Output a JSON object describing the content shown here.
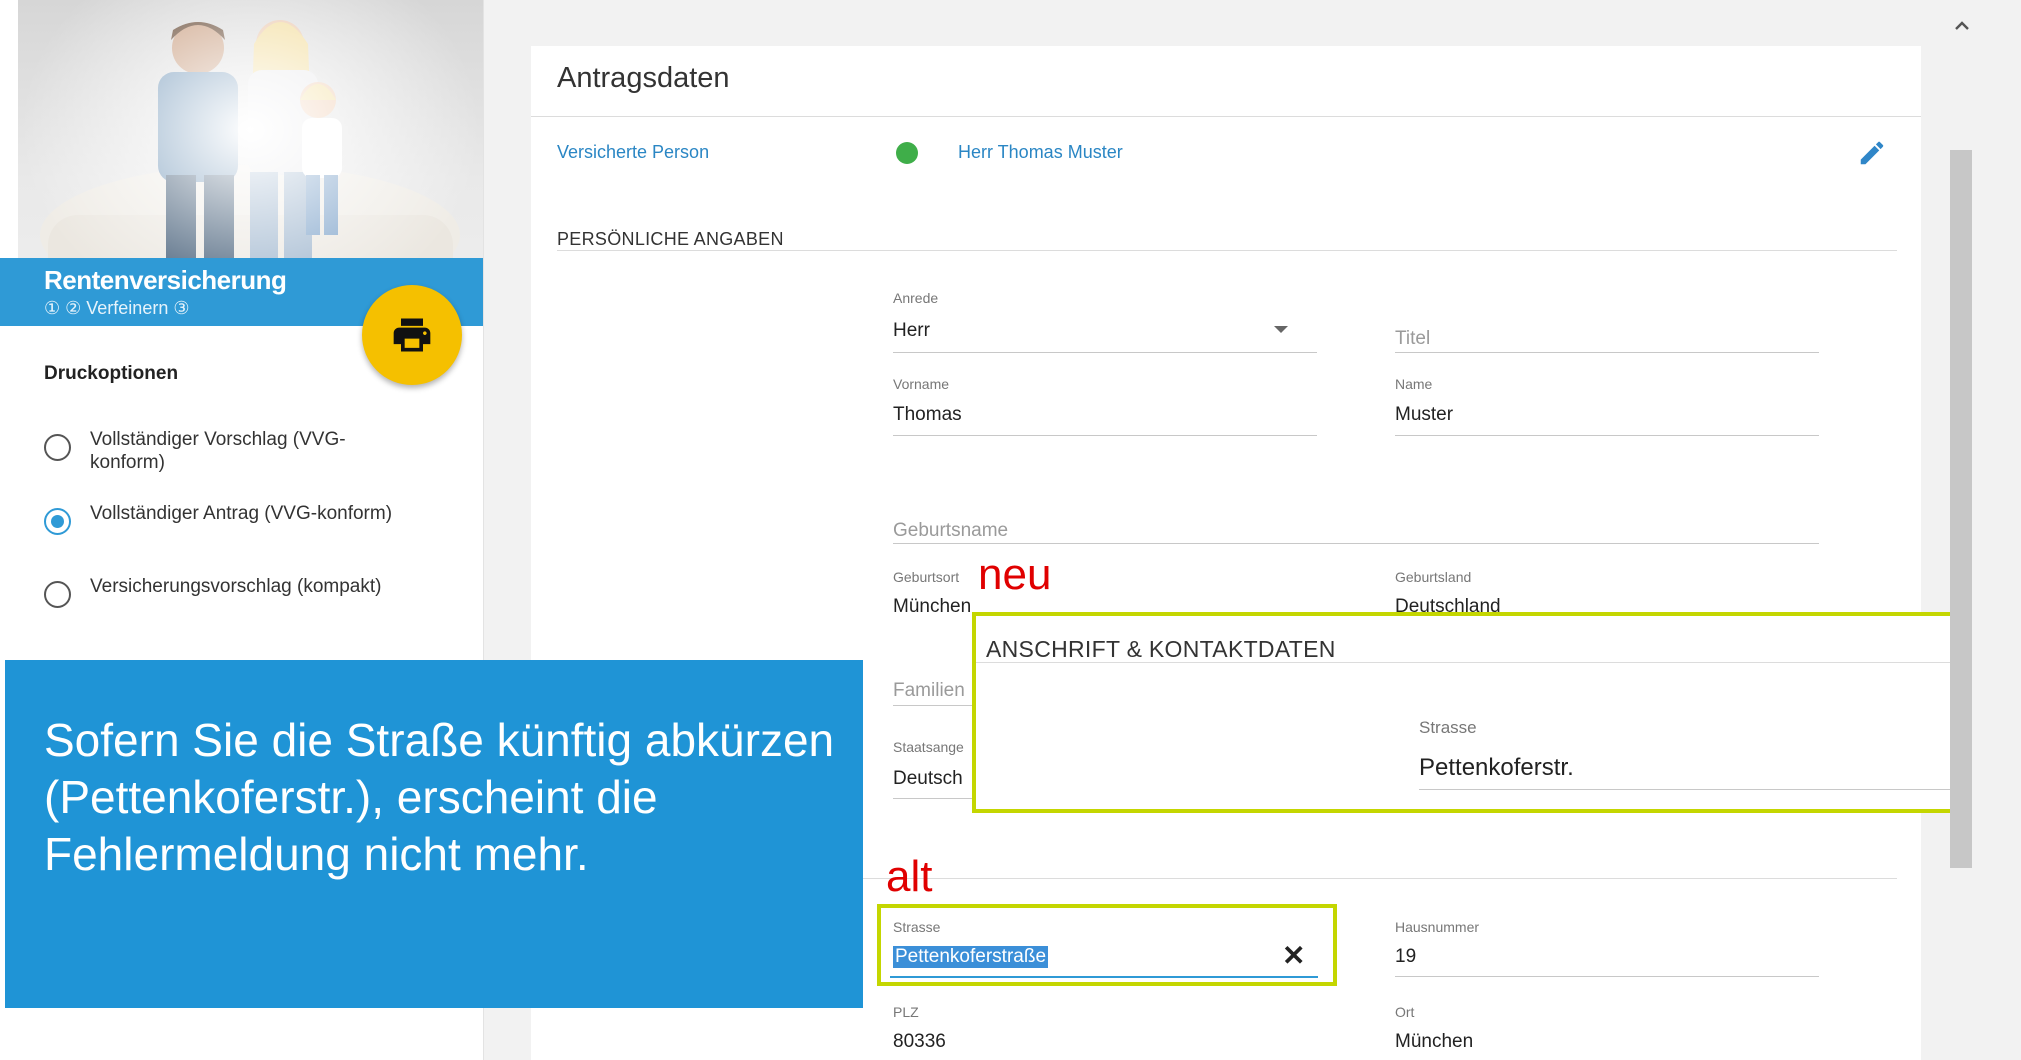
{
  "sidebar": {
    "product_name": "Rentenversicherung",
    "product_steps": "① ② Verfeinern ③",
    "print_options_title": "Druckoptionen",
    "print_options": [
      {
        "label": "Vollständiger Vorschlag (VVG-konform)",
        "selected": false
      },
      {
        "label": "Vollständiger Antrag (VVG-konform)",
        "selected": true
      },
      {
        "label": "Versicherungsvorschlag (kompakt)",
        "selected": false
      }
    ],
    "print_icon": "printer-icon"
  },
  "main": {
    "title": "Antragsdaten",
    "insured_label": "Versicherte Person",
    "insured_name": "Herr Thomas Muster",
    "insured_status_color": "#3fae49",
    "section_personal": "PERSÖNLICHE ANGABEN",
    "fields": {
      "anrede": {
        "label": "Anrede",
        "value": "Herr"
      },
      "titel": {
        "placeholder": "Titel"
      },
      "vorname": {
        "label": "Vorname",
        "value": "Thomas"
      },
      "name": {
        "label": "Name",
        "value": "Muster"
      },
      "geburtsname": {
        "placeholder": "Geburtsname"
      },
      "geburtsort": {
        "label": "Geburtsort",
        "value": "München"
      },
      "geburtsland": {
        "label": "Geburtsland",
        "value": "Deutschland"
      },
      "familienstand": {
        "placeholder": "Familien"
      },
      "staatsangehoerigkeit": {
        "label": "Staatsange",
        "value": "Deutsch"
      },
      "strasse": {
        "label": "Strasse",
        "value": "Pettenkoferstraße"
      },
      "hausnummer": {
        "label": "Hausnummer",
        "value": "19"
      },
      "plz": {
        "label": "PLZ",
        "value": "80336"
      },
      "ort": {
        "label": "Ort",
        "value": "München"
      }
    }
  },
  "overlay": {
    "callout_text": "Sofern Sie die Straße künftig abkürzen (Pettenkoferstr.), erscheint die Fehlermeldung nicht mehr.",
    "neu_label": "neu",
    "alt_label": "alt",
    "new_section_title": "ANSCHRIFT & KONTAKTDATEN",
    "new_strasse_label": "Strasse",
    "new_strasse_value": "Pettenkoferstr.",
    "clear_symbol": "✕"
  },
  "colors": {
    "accent": "#2f9ad6",
    "callout": "#1f94d6",
    "highlight_border": "#c4d600",
    "annotation_red": "#e00000",
    "fab": "#f5c000"
  }
}
